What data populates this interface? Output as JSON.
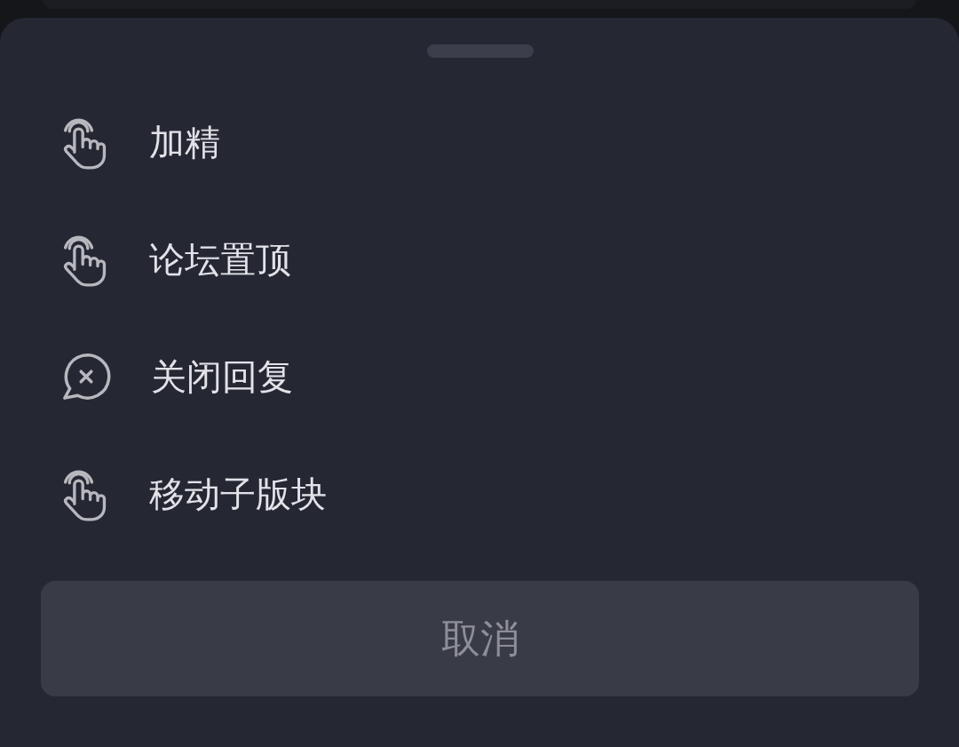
{
  "action_sheet": {
    "items": [
      {
        "kind": "tap",
        "label": "加精"
      },
      {
        "kind": "tap",
        "label": "论坛置顶"
      },
      {
        "kind": "close-reply",
        "label": "关闭回复"
      },
      {
        "kind": "tap",
        "label": "移动子版块"
      }
    ],
    "cancel_button": {
      "label": "取消"
    }
  }
}
